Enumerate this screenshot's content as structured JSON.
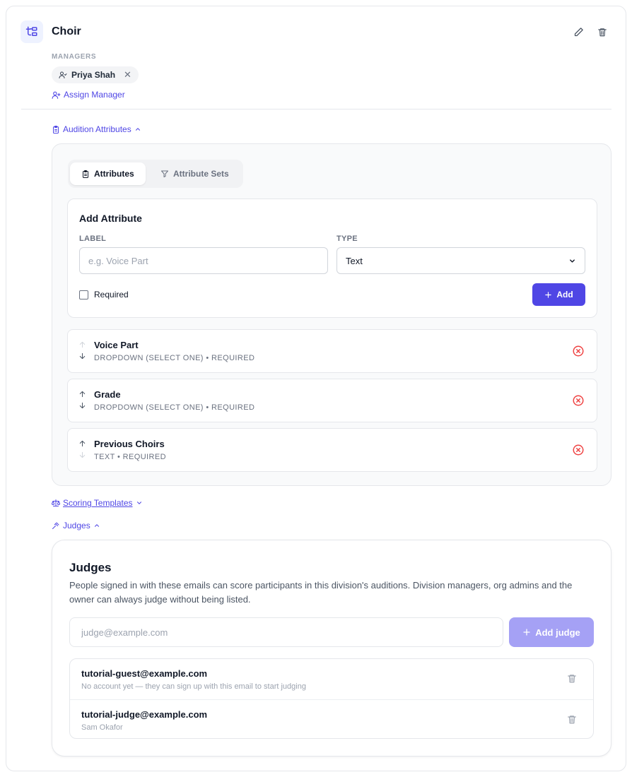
{
  "division": {
    "title": "Choir",
    "managers_label": "MANAGERS",
    "managers": [
      {
        "name": "Priya Shah",
        "remove_glyph": "✕"
      }
    ],
    "assign_manager_label": "Assign Manager"
  },
  "sections": {
    "audition_attributes": "Audition Attributes",
    "scoring_templates": "Scoring Templates",
    "judges": "Judges"
  },
  "attributes_panel": {
    "tabs": [
      {
        "label": "Attributes",
        "icon": "clipboard-icon",
        "active": true
      },
      {
        "label": "Attribute Sets",
        "icon": "filter-icon",
        "active": false
      }
    ],
    "add_form": {
      "title": "Add Attribute",
      "label_field": {
        "label": "LABEL",
        "placeholder": "e.g. Voice Part",
        "value": ""
      },
      "type_field": {
        "label": "TYPE",
        "value": "Text"
      },
      "required_label": "Required",
      "required_checked": false,
      "add_button": "Add"
    },
    "attributes": [
      {
        "name": "Voice Part",
        "meta": "DROPDOWN (SELECT ONE) • REQUIRED",
        "can_move_up": false,
        "can_move_down": true
      },
      {
        "name": "Grade",
        "meta": "DROPDOWN (SELECT ONE) • REQUIRED",
        "can_move_up": true,
        "can_move_down": true
      },
      {
        "name": "Previous Choirs",
        "meta": "TEXT • REQUIRED",
        "can_move_up": true,
        "can_move_down": false
      }
    ]
  },
  "judges_panel": {
    "title": "Judges",
    "description": "People signed in with these emails can score participants in this division's auditions. Division managers, org admins and the owner can always judge without being listed.",
    "input_placeholder": "judge@example.com",
    "add_button": "Add judge",
    "judges": [
      {
        "email": "tutorial-guest@example.com",
        "subtitle": "No account yet — they can sign up with this email to start judging"
      },
      {
        "email": "tutorial-judge@example.com",
        "subtitle": "Sam Okafor"
      }
    ]
  },
  "colors": {
    "accent": "#4f46e5",
    "accent_disabled": "#a5a1f5",
    "danger": "#ef4444",
    "muted": "#6b7280"
  }
}
